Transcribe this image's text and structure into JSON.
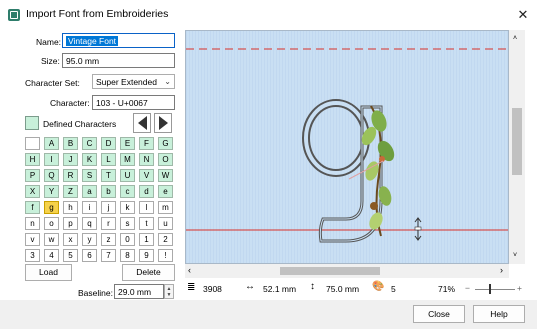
{
  "window": {
    "title": "Import Font from Embroideries",
    "close_glyph": "✕"
  },
  "form": {
    "name_label": "Name:",
    "name_value": "Vintage Font",
    "size_label": "Size:",
    "size_value": "95.0 mm",
    "charset_label": "Character Set:",
    "charset_value": "Super Extended",
    "character_label": "Character:",
    "character_value": "103 - U+0067"
  },
  "defined_characters": {
    "label": "Defined Characters",
    "rows": [
      [
        {
          "c": "",
          "s": "undef"
        },
        {
          "c": "A",
          "s": "def"
        },
        {
          "c": "B",
          "s": "def"
        },
        {
          "c": "C",
          "s": "def"
        },
        {
          "c": "D",
          "s": "def"
        },
        {
          "c": "E",
          "s": "def"
        },
        {
          "c": "F",
          "s": "def"
        },
        {
          "c": "G",
          "s": "def"
        }
      ],
      [
        {
          "c": "H",
          "s": "def"
        },
        {
          "c": "I",
          "s": "def"
        },
        {
          "c": "J",
          "s": "def"
        },
        {
          "c": "K",
          "s": "def"
        },
        {
          "c": "L",
          "s": "def"
        },
        {
          "c": "M",
          "s": "def"
        },
        {
          "c": "N",
          "s": "def"
        },
        {
          "c": "O",
          "s": "def"
        }
      ],
      [
        {
          "c": "P",
          "s": "def"
        },
        {
          "c": "Q",
          "s": "def"
        },
        {
          "c": "R",
          "s": "def"
        },
        {
          "c": "S",
          "s": "def"
        },
        {
          "c": "T",
          "s": "def"
        },
        {
          "c": "U",
          "s": "def"
        },
        {
          "c": "V",
          "s": "def"
        },
        {
          "c": "W",
          "s": "def"
        }
      ],
      [
        {
          "c": "X",
          "s": "def"
        },
        {
          "c": "Y",
          "s": "def"
        },
        {
          "c": "Z",
          "s": "def"
        },
        {
          "c": "a",
          "s": "def"
        },
        {
          "c": "b",
          "s": "def"
        },
        {
          "c": "c",
          "s": "def"
        },
        {
          "c": "d",
          "s": "def"
        },
        {
          "c": "e",
          "s": "def"
        }
      ],
      [
        {
          "c": "f",
          "s": "def"
        },
        {
          "c": "g",
          "s": "sel"
        },
        {
          "c": "h",
          "s": "undef"
        },
        {
          "c": "i",
          "s": "undef"
        },
        {
          "c": "j",
          "s": "undef"
        },
        {
          "c": "k",
          "s": "undef"
        },
        {
          "c": "l",
          "s": "undef"
        },
        {
          "c": "m",
          "s": "undef"
        }
      ],
      [
        {
          "c": "n",
          "s": "undef"
        },
        {
          "c": "o",
          "s": "undef"
        },
        {
          "c": "p",
          "s": "undef"
        },
        {
          "c": "q",
          "s": "undef"
        },
        {
          "c": "r",
          "s": "undef"
        },
        {
          "c": "s",
          "s": "undef"
        },
        {
          "c": "t",
          "s": "undef"
        },
        {
          "c": "u",
          "s": "undef"
        }
      ],
      [
        {
          "c": "v",
          "s": "undef"
        },
        {
          "c": "w",
          "s": "undef"
        },
        {
          "c": "x",
          "s": "undef"
        },
        {
          "c": "y",
          "s": "undef"
        },
        {
          "c": "z",
          "s": "undef"
        },
        {
          "c": "0",
          "s": "undef"
        },
        {
          "c": "1",
          "s": "undef"
        },
        {
          "c": "2",
          "s": "undef"
        }
      ],
      [
        {
          "c": "3",
          "s": "undef"
        },
        {
          "c": "4",
          "s": "undef"
        },
        {
          "c": "5",
          "s": "undef"
        },
        {
          "c": "6",
          "s": "undef"
        },
        {
          "c": "7",
          "s": "undef"
        },
        {
          "c": "8",
          "s": "undef"
        },
        {
          "c": "9",
          "s": "undef"
        },
        {
          "c": "!",
          "s": "undef"
        }
      ]
    ]
  },
  "buttons": {
    "load": "Load",
    "delete": "Delete",
    "close": "Close",
    "help": "Help"
  },
  "baseline": {
    "label": "Baseline:",
    "value": "29.0 mm"
  },
  "status": {
    "stitches": "3908",
    "width": "52.1 mm",
    "height": "75.0 mm",
    "colors": "5",
    "zoom": "71%",
    "zoom_minus": "−",
    "zoom_plus": "+"
  },
  "colors": {
    "accent": "#0078d7",
    "defined": "#c8f0da",
    "selected": "#f6d24a",
    "canvas": "#c9dff3"
  },
  "icons": {
    "stitches": "stitch-count-icon",
    "width": "width-arrow-icon",
    "height": "height-arrow-icon",
    "colors": "palette-icon"
  }
}
